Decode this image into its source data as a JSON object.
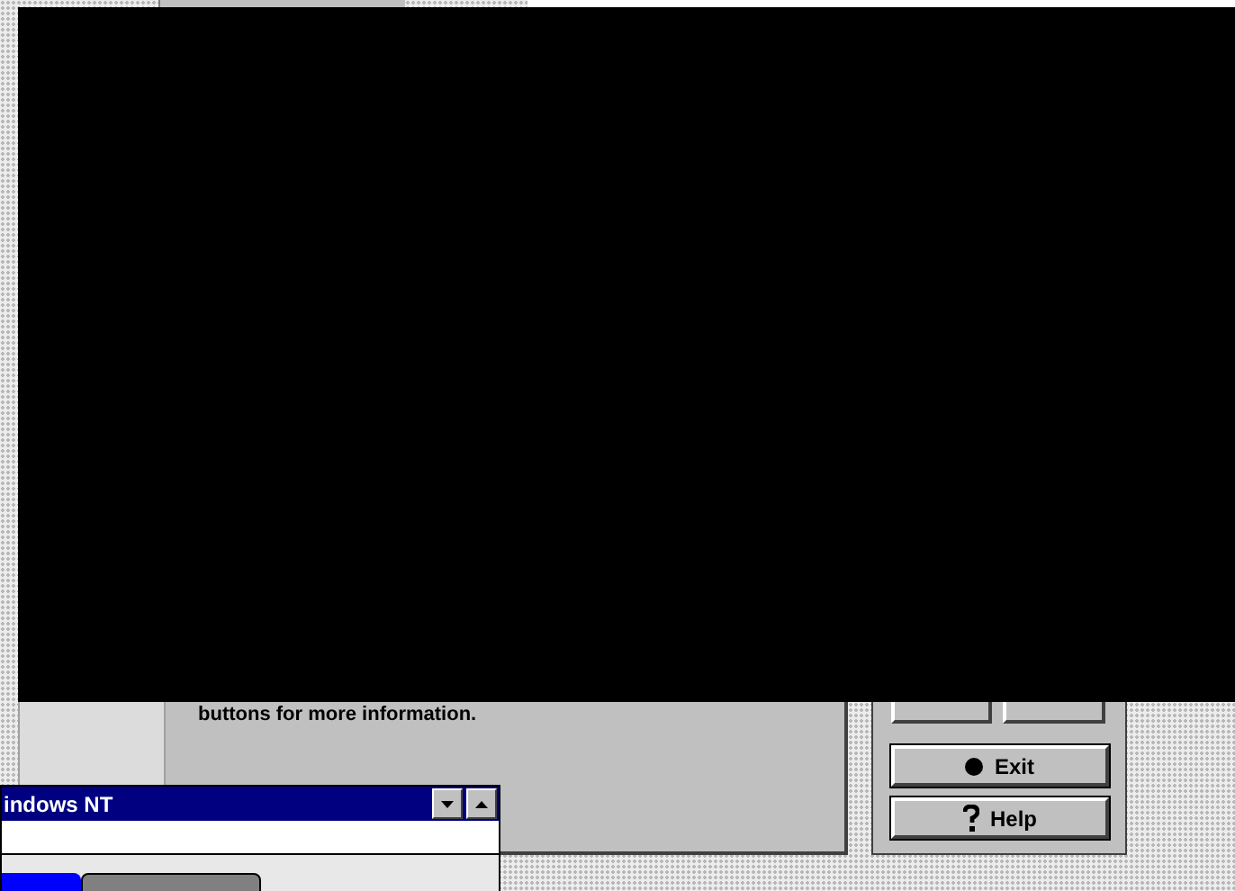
{
  "info_panel": {
    "text": "buttons for more information."
  },
  "nav_buttons": [
    {
      "label": "Exit"
    },
    {
      "label": "Help"
    }
  ],
  "nt_window": {
    "title": "indows NT"
  }
}
